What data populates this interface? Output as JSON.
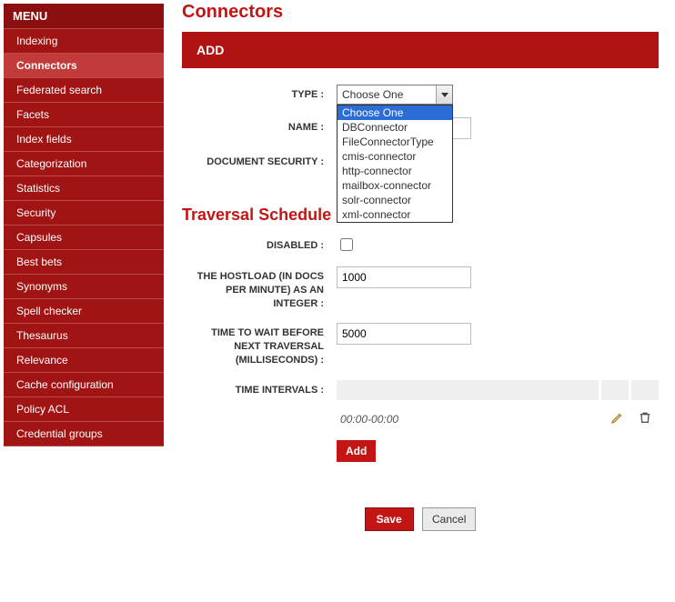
{
  "sidebar": {
    "header": "MENU",
    "items": [
      {
        "label": "Indexing"
      },
      {
        "label": "Connectors",
        "active": true
      },
      {
        "label": "Federated search"
      },
      {
        "label": "Facets"
      },
      {
        "label": "Index fields"
      },
      {
        "label": "Categorization"
      },
      {
        "label": "Statistics"
      },
      {
        "label": "Security"
      },
      {
        "label": "Capsules"
      },
      {
        "label": "Best bets"
      },
      {
        "label": "Synonyms"
      },
      {
        "label": "Spell checker"
      },
      {
        "label": "Thesaurus"
      },
      {
        "label": "Relevance"
      },
      {
        "label": "Cache configuration"
      },
      {
        "label": "Policy ACL"
      },
      {
        "label": "Credential groups"
      }
    ]
  },
  "page": {
    "title": "Connectors",
    "add_header": "ADD"
  },
  "form": {
    "type_label": "TYPE :",
    "type_selected": "Choose One",
    "type_options": [
      "Choose One",
      "DBConnector",
      "FileConnectorType",
      "cmis-connector",
      "http-connector",
      "mailbox-connector",
      "solr-connector",
      "xml-connector"
    ],
    "name_label": "NAME :",
    "name_value": "",
    "docsec_label": "DOCUMENT SECURITY :"
  },
  "traversal": {
    "title": "Traversal Schedule",
    "disabled_label": "DISABLED :",
    "disabled_value": false,
    "hostload_label": "THE HOSTLOAD (IN DOCS PER MINUTE) AS AN INTEGER :",
    "hostload_value": "1000",
    "wait_label": "TIME TO WAIT BEFORE NEXT TRAVERSAL (MILLISECONDS) :",
    "wait_value": "5000",
    "intervals_label": "TIME INTERVALS :",
    "interval_rows": [
      {
        "value": "00:00-00:00"
      }
    ],
    "add_label": "Add"
  },
  "actions": {
    "save": "Save",
    "cancel": "Cancel"
  }
}
